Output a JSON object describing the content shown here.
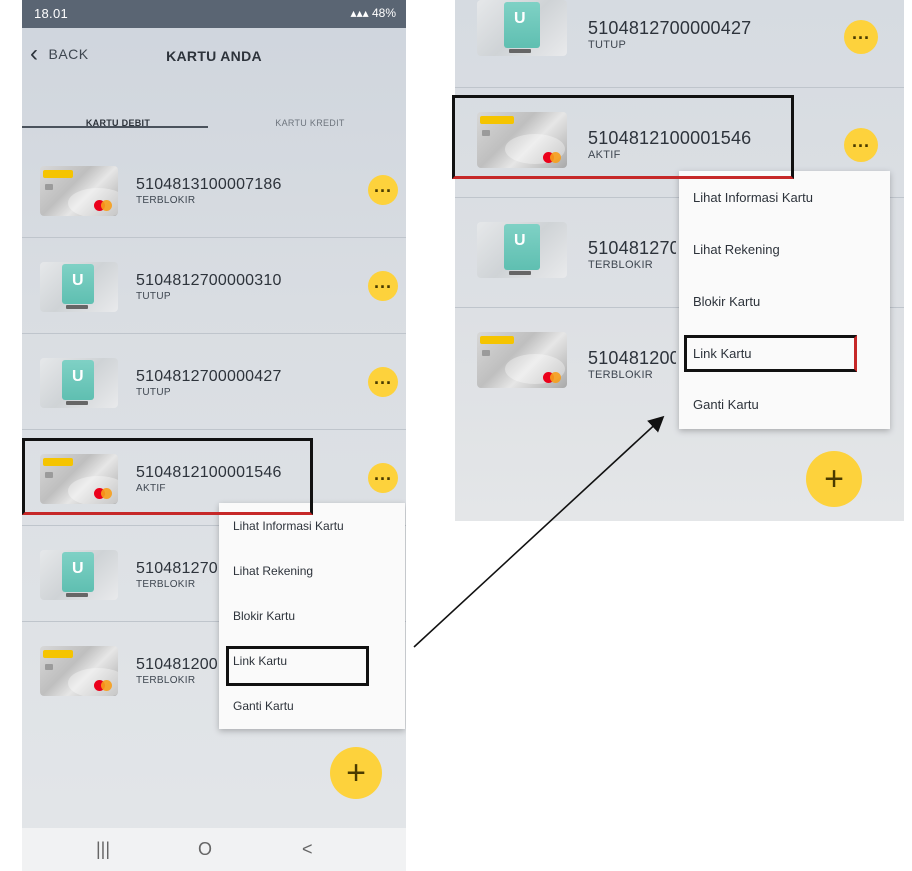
{
  "status_bar": {
    "time": "18.01",
    "battery": "48%"
  },
  "app": {
    "back_label": "BACK",
    "title": "KARTU ANDA"
  },
  "tabs": [
    {
      "label": "KARTU DEBIT"
    },
    {
      "label": "KARTU KREDIT"
    }
  ],
  "cards": [
    {
      "number": "5104813100007186",
      "status": "TERBLOKIR",
      "type": "maybank"
    },
    {
      "number": "5104812700000310",
      "status": "TUTUP",
      "type": "m-brand"
    },
    {
      "number": "5104812700000427",
      "status": "TUTUP",
      "type": "m-brand"
    },
    {
      "number": "5104812100001546",
      "status": "AKTIF",
      "type": "maybank"
    },
    {
      "number": "510481270",
      "status": "TERBLOKIR",
      "type": "m-brand"
    },
    {
      "number": "510481200",
      "status": "TERBLOKIR",
      "type": "maybank"
    }
  ],
  "menu": {
    "items": [
      {
        "label": "Lihat Informasi Kartu"
      },
      {
        "label": "Lihat Rekening"
      },
      {
        "label": "Blokir Kartu"
      },
      {
        "label": "Link Kartu"
      },
      {
        "label": "Ganti Kartu"
      }
    ]
  },
  "more_icon": "ellipsis-icon",
  "fab_icon": "plus-icon",
  "nav": {
    "recent": "|||",
    "home": "O",
    "back": "<"
  },
  "accent_color": "#fdd23c"
}
